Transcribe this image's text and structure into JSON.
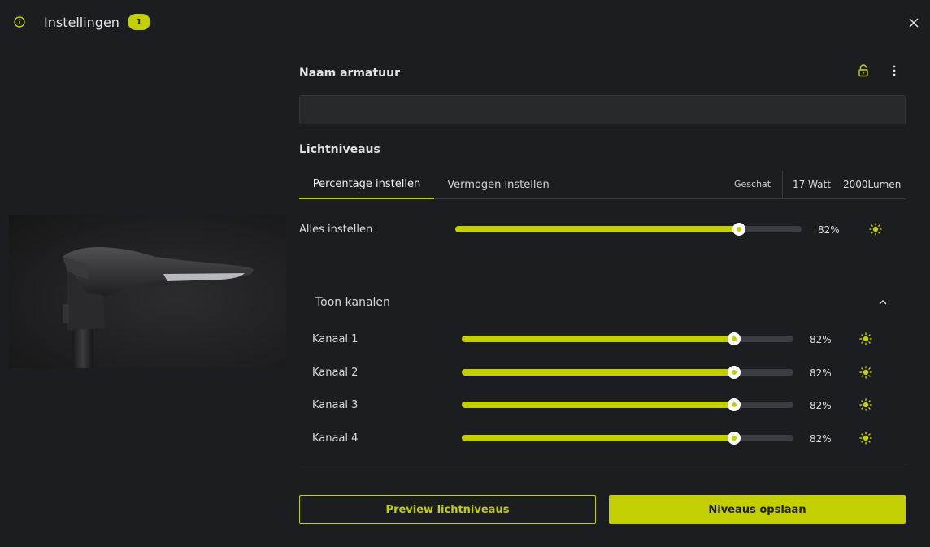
{
  "header": {
    "title": "Instellingen",
    "badge": "1"
  },
  "fixture": {
    "name_heading": "Naam armatuur",
    "name_value": "",
    "name_placeholder": ""
  },
  "light_levels": {
    "heading": "Lichtniveaus",
    "tabs": [
      {
        "label": "Percentage instellen",
        "active": true
      },
      {
        "label": "Vermogen instellen",
        "active": false
      }
    ],
    "estimate": {
      "label": "Geschat",
      "watt": "17 Watt",
      "lumen": "2000Lumen"
    },
    "all": {
      "label": "Alles instellen",
      "value": 82,
      "value_text": "82%"
    },
    "channels_toggle": {
      "label": "Toon kanalen",
      "expanded": true
    },
    "channels": [
      {
        "label": "Kanaal 1",
        "value": 82,
        "value_text": "82%"
      },
      {
        "label": "Kanaal 2",
        "value": 82,
        "value_text": "82%"
      },
      {
        "label": "Kanaal 3",
        "value": 82,
        "value_text": "82%"
      },
      {
        "label": "Kanaal 4",
        "value": 82,
        "value_text": "82%"
      }
    ]
  },
  "actions": {
    "preview_label": "Preview lichtniveaus",
    "save_label": "Niveaus opslaan"
  },
  "icons": {
    "info": "info-circle-icon",
    "close": "close-icon",
    "lock": "lock-open-icon",
    "more": "more-vertical-icon",
    "sun": "sun-icon",
    "chevron": "chevron-up-icon"
  },
  "colors": {
    "accent": "#c3cf00",
    "background": "#1c1d21",
    "input_background": "#28292d",
    "track": "#3c3d42"
  }
}
